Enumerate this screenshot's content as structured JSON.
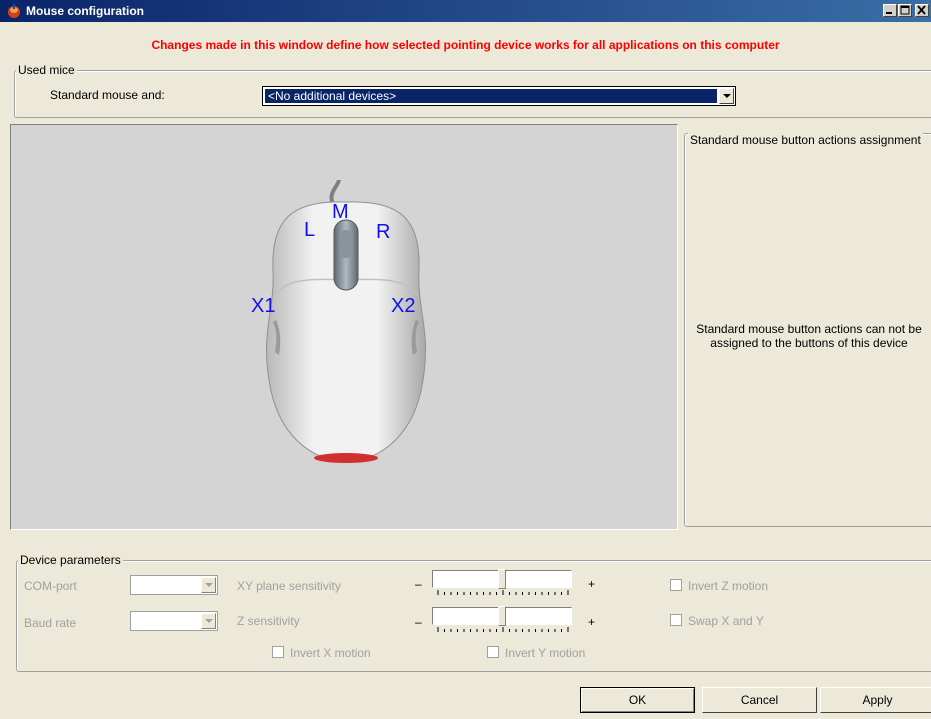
{
  "window": {
    "title": "Mouse configuration",
    "warning": "Changes made in this window define how selected pointing device works for all applications on this computer"
  },
  "used_mice": {
    "group_label": "Used mice",
    "standard_label": "Standard mouse and:",
    "device_selected": "<No additional devices>"
  },
  "mouse_labels": {
    "left": "L",
    "middle": "M",
    "right": "R",
    "x1": "X1",
    "x2": "X2"
  },
  "actions": {
    "group_label": "Standard mouse button actions assignment",
    "message": "Standard mouse button actions can not be assigned to the buttons of this device"
  },
  "params": {
    "group_label": "Device parameters",
    "com_port_label": "COM-port",
    "baud_rate_label": "Baud rate",
    "xy_label": "XY plane sensitivity",
    "z_label": "Z sensitivity",
    "minus": "–",
    "plus": "+",
    "xy_level": 0.5,
    "z_level": 0.5,
    "invert_z": "Invert Z motion",
    "swap_xy": "Swap X and Y",
    "invert_x": "Invert X motion",
    "invert_y": "Invert Y motion"
  },
  "buttons": {
    "ok": "OK",
    "cancel": "Cancel",
    "apply": "Apply"
  },
  "colors": {
    "warning": "#ff0000",
    "title_bar": "#0a246a",
    "mouse_labels": "#1010ee"
  }
}
